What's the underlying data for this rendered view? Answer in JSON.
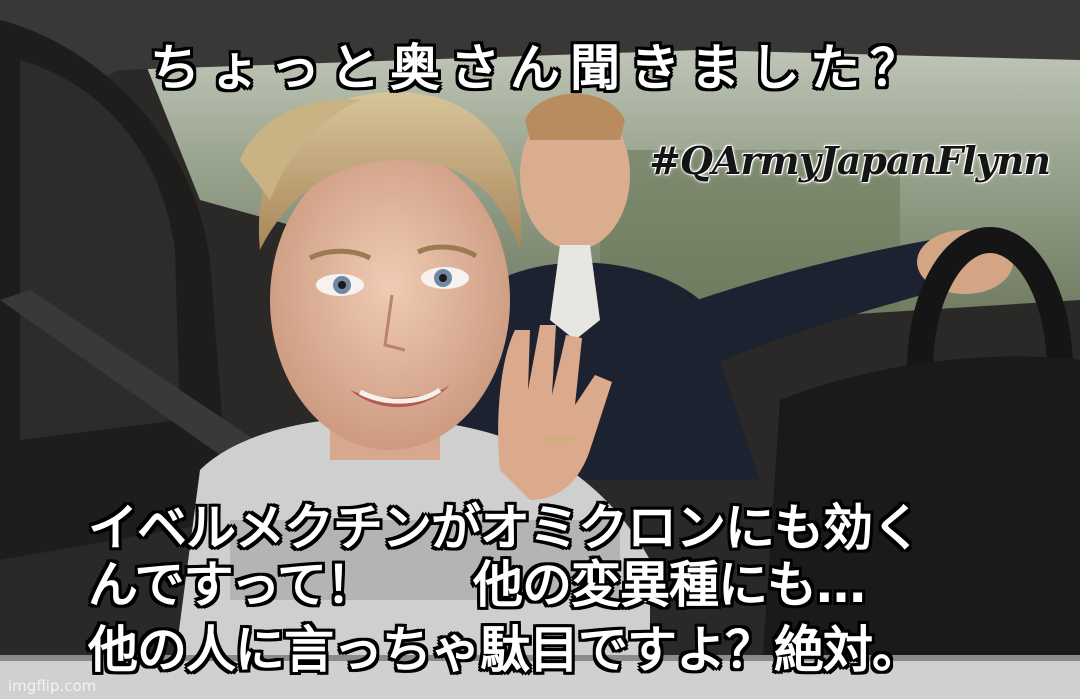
{
  "captions": {
    "top": "ちょっと奥さん聞きました？",
    "hashtag": "#QArmyJapanFlynn",
    "line1": "イベルメクチンがオミクロンにも効く",
    "line2": "んですって！　　他の変異種にも…",
    "line3": "他の人に言っちゃ駄目ですよ？絶対。"
  },
  "watermark": "imgflip.com"
}
